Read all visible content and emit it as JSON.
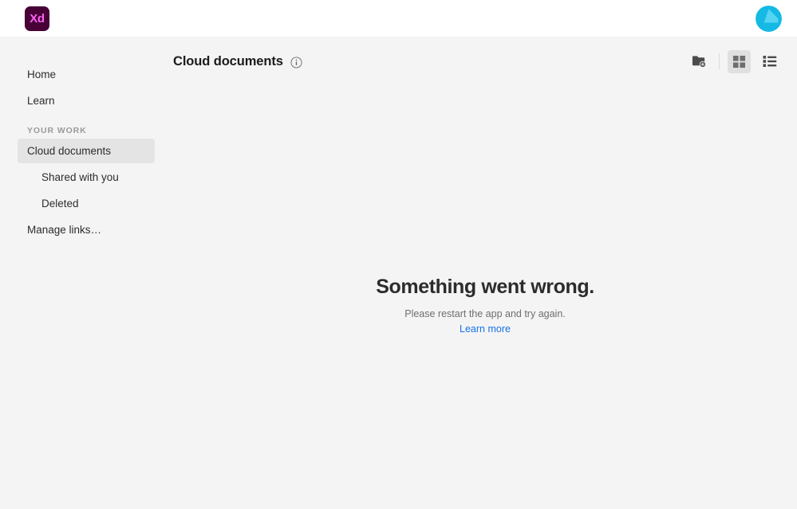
{
  "app": {
    "logo_text": "Xd",
    "logo_bg": "#470137",
    "logo_fg": "#ff61f6",
    "avatar_color": "#14b9e4",
    "avatar_highlight": "#4fd2f0"
  },
  "sidebar": {
    "items": [
      {
        "label": "Home",
        "type": "link",
        "selected": false
      },
      {
        "label": "Learn",
        "type": "link",
        "selected": false
      }
    ],
    "section_label": "YOUR WORK",
    "work_items": [
      {
        "label": "Cloud documents",
        "type": "link",
        "selected": true
      },
      {
        "label": "Shared with you",
        "type": "sublink",
        "selected": false
      },
      {
        "label": "Deleted",
        "type": "sublink",
        "selected": false
      }
    ],
    "footer_item": {
      "label": "Manage links…"
    }
  },
  "header": {
    "title": "Cloud documents",
    "info_icon": "info-circle-icon",
    "tools": [
      {
        "name": "new-folder-icon",
        "label": "New folder",
        "active": false
      },
      {
        "name": "grid-view-icon",
        "label": "Grid view",
        "active": true
      },
      {
        "name": "list-view-icon",
        "label": "List view",
        "active": false
      }
    ]
  },
  "main": {
    "error_title": "Something went wrong.",
    "error_subtitle": "Please restart the app and try again.",
    "error_link": "Learn more",
    "link_color": "#1473e6"
  }
}
